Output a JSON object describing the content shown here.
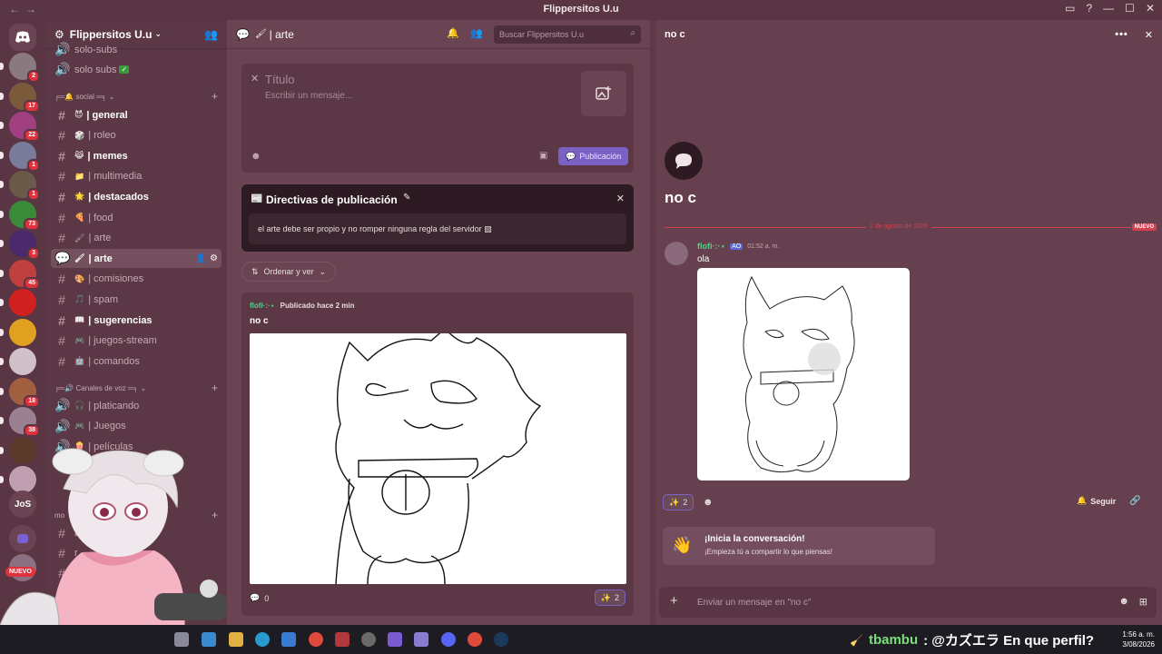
{
  "window": {
    "title": "Flippersitos U.u"
  },
  "servers": [
    {
      "badge": "2",
      "color": "#8a7a80"
    },
    {
      "badge": "17",
      "color": "#7a5a3a"
    },
    {
      "badge": "22",
      "color": "#a04080"
    },
    {
      "badge": "1",
      "color": "#7a7a9a"
    },
    {
      "badge": "1",
      "color": "#6a5a4a"
    },
    {
      "badge": "73",
      "color": "#3a8a3a"
    },
    {
      "badge": "3",
      "color": "#4a2a6a"
    },
    {
      "badge": "45",
      "color": "#c04040"
    },
    {
      "badge": "",
      "color": "#d02020"
    },
    {
      "badge": "",
      "color": "#e0a020"
    },
    {
      "badge": "",
      "color": "#d0c0c8"
    },
    {
      "badge": "18",
      "color": "#a06040"
    },
    {
      "badge": "38",
      "color": "#9a8090"
    },
    {
      "badge": "",
      "color": "#5a3a2a"
    },
    {
      "badge": "",
      "color": "#c0a0b0"
    }
  ],
  "server_jos": "JoS",
  "nuevo_badge": "NUEVO",
  "sidebar": {
    "guild_name": "Flippersitos U.u",
    "top_items": [
      "solo-subs",
      "solo subs"
    ],
    "cat_social": "social",
    "channels": [
      {
        "label": "| general",
        "emoji": "😈"
      },
      {
        "label": "| roleo",
        "emoji": "🎲"
      },
      {
        "label": "| memes",
        "emoji": "😹"
      },
      {
        "label": "| multimedia",
        "emoji": "📁"
      },
      {
        "label": "| destacados",
        "emoji": "🌟"
      },
      {
        "label": "| food",
        "emoji": "🍕"
      },
      {
        "label": "| arte",
        "emoji": "🖌"
      },
      {
        "label": "| arte",
        "emoji": "🖌"
      },
      {
        "label": "| comisiones",
        "emoji": "🎨"
      },
      {
        "label": "| spam",
        "emoji": "🎵"
      },
      {
        "label": "| sugerencias",
        "emoji": "📖"
      },
      {
        "label": "| juegos-stream",
        "emoji": "🎮"
      },
      {
        "label": "| comandos",
        "emoji": "🤖"
      }
    ],
    "cat_voice": "Canales de voz",
    "voice": [
      {
        "label": "| platicando",
        "emoji": "🎧"
      },
      {
        "label": "| Juegos",
        "emoji": "🎮"
      },
      {
        "label": "| películas",
        "emoji": "🍿"
      }
    ],
    "cat_mod": "mo",
    "mod_items": [
      "adm",
      "r",
      "r"
    ]
  },
  "forum": {
    "channel_name": "| arte",
    "search_placeholder": "Buscar Flippersitos U.u",
    "composer": {
      "title_placeholder": "Título",
      "body_placeholder": "Escribir un mensaje...",
      "publish_label": "Publicación"
    },
    "guidelines": {
      "heading": "Directivas de publicación",
      "text": "el arte debe ser propio y no romper ninguna regla del servidor"
    },
    "sort_label": "Ordenar y ver",
    "post": {
      "author": "flofi·:·⋆",
      "meta": "Publicado hace 2 min",
      "title": "no c",
      "comments": "0",
      "reactions": "2"
    }
  },
  "thread": {
    "title": "no c",
    "big_title": "no c",
    "date_divider": "1 de agosto de 2026",
    "new_label": "NUEVO",
    "message": {
      "author": "flofi·:·⋆",
      "tag": "AO",
      "time": "01:52 a. m.",
      "text": "ola"
    },
    "reaction_count": "2",
    "follow_label": "Seguir",
    "starter": {
      "heading": "¡Inicia la conversación!",
      "subtext": "¡Empieza tú a compartir lo que piensas!"
    },
    "input_placeholder": "Enviar un mensaje en \"no c\""
  },
  "ticker": {
    "user": "tbambu",
    "text": ": @カズエラ En que perfil?"
  },
  "clock": {
    "time": "1:56 a. m.",
    "date": "3/08/2026"
  }
}
